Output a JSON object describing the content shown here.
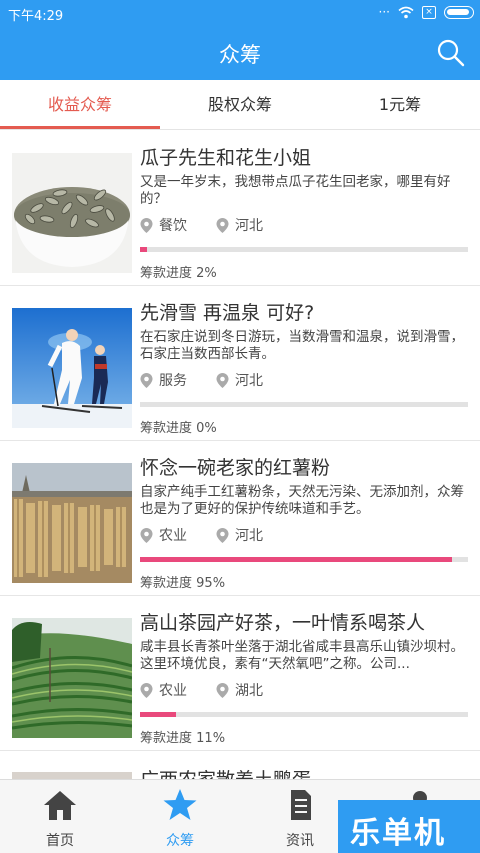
{
  "status_bar": {
    "time": "下午4:29",
    "dots": "···"
  },
  "header": {
    "title": "众筹"
  },
  "tabs": [
    {
      "label": "收益众筹",
      "active": true
    },
    {
      "label": "股权众筹",
      "active": false
    },
    {
      "label": "1元筹",
      "active": false
    }
  ],
  "items": [
    {
      "title": "瓜子先生和花生小姐",
      "description": "又是一年岁末，我想带点瓜子花生回老家，哪里有好的？",
      "category": "餐饮",
      "location": "河北",
      "progress_label": "筹款进度",
      "progress": "2%",
      "progress_value": 0.02,
      "image": "sunflower-seeds-bowl"
    },
    {
      "title": "先滑雪 再温泉 可好?",
      "description": "在石家庄说到冬日游玩，当数滑雪和温泉，说到滑雪，石家庄当数西部长青。",
      "category": "服务",
      "location": "河北",
      "progress_label": "筹款进度",
      "progress": "0%",
      "progress_value": 0.0,
      "image": "skiers"
    },
    {
      "title": "怀念一碗老家的红薯粉",
      "description": "自家产纯手工红薯粉条，天然无污染、无添加剂，众筹也是为了更好的保护传统味道和手艺。",
      "category": "农业",
      "location": "河北",
      "progress_label": "筹款进度",
      "progress": "95%",
      "progress_value": 0.95,
      "image": "drying-noodles"
    },
    {
      "title": "高山茶园产好茶，一叶情系喝茶人",
      "description": "咸丰县长青茶叶坐落于湖北省咸丰县高乐山镇沙坝村。这里环境优良，素有“天然氧吧”之称。公司...",
      "category": "农业",
      "location": "湖北",
      "progress_label": "筹款进度",
      "progress": "11%",
      "progress_value": 0.11,
      "image": "tea-terraces"
    }
  ],
  "partial_item": {
    "title": "广西农家散养土鹏蛋"
  },
  "bottom_nav": [
    {
      "label": "首页",
      "icon": "home-icon",
      "active": false
    },
    {
      "label": "众筹",
      "icon": "star-icon",
      "active": true
    },
    {
      "label": "资讯",
      "icon": "document-icon",
      "active": false
    },
    {
      "label": "我的",
      "icon": "person-icon",
      "active": false
    }
  ],
  "watermark": {
    "text": "乐单机"
  },
  "colors": {
    "primary": "#2f9cf2",
    "active_tab": "#e45b50",
    "progress": "#e9497c"
  }
}
